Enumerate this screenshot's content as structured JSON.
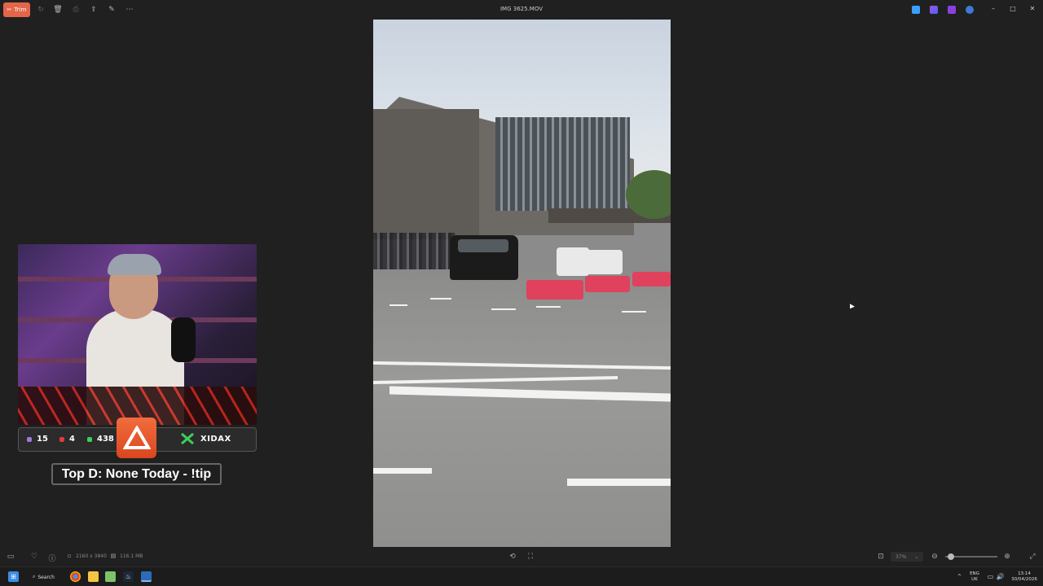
{
  "toolbar": {
    "trim_label": "Trim",
    "title": "IMG 3625.MOV"
  },
  "overlay": {
    "stats": [
      {
        "value": "15",
        "color": "#9a7bd8"
      },
      {
        "value": "4",
        "color": "#e03a3a"
      },
      {
        "value": "438",
        "color": "#3fcf5a"
      }
    ],
    "sponsor": "XIDAX",
    "banner": "Top D: None Today - !tip"
  },
  "statusbar": {
    "resolution": "2160 x 3840",
    "filesize": "116.1 MB",
    "zoom": "37%"
  },
  "taskbar": {
    "search_label": "Search",
    "lang_top": "ENG",
    "lang_bottom": "UK",
    "time": "13:14",
    "date": "30/04/2026"
  },
  "colors": {
    "accent": "#e3664a",
    "background": "#202020"
  }
}
